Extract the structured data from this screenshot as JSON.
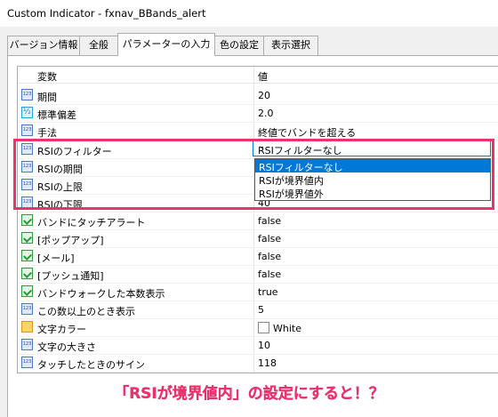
{
  "window": {
    "title": "Custom Indicator - fxnav_BBands_alert"
  },
  "tabs": [
    {
      "label": "バージョン情報"
    },
    {
      "label": "全般"
    },
    {
      "label": "パラメーターの入力"
    },
    {
      "label": "色の設定"
    },
    {
      "label": "表示選択"
    }
  ],
  "grid": {
    "col_name": "変数",
    "col_value": "値",
    "rows": [
      {
        "icon": "number-icon",
        "name": "期間",
        "value": "20"
      },
      {
        "icon": "fraction-icon",
        "name": "標準偏差",
        "value": "2.0"
      },
      {
        "icon": "number-icon",
        "name": "手法",
        "value": "終値でバンドを超える"
      },
      {
        "icon": "number-icon",
        "name": "RSIのフィルター",
        "value": "RSIフィルターなし"
      },
      {
        "icon": "number-icon",
        "name": "RSIの期間",
        "value": ""
      },
      {
        "icon": "number-icon",
        "name": "RSIの上限",
        "value": ""
      },
      {
        "icon": "number-icon",
        "name": "RSIの下限",
        "value": "40"
      },
      {
        "icon": "bool-icon",
        "name": "バンドにタッチアラート",
        "value": "false"
      },
      {
        "icon": "bool-icon",
        "name": "[ポップアップ]",
        "value": "false"
      },
      {
        "icon": "bool-icon",
        "name": "[メール]",
        "value": "false"
      },
      {
        "icon": "bool-icon",
        "name": "[プッシュ通知]",
        "value": "false"
      },
      {
        "icon": "bool-icon",
        "name": "バンドウォークした本数表示",
        "value": "true"
      },
      {
        "icon": "number-icon",
        "name": "この数以上のとき表示",
        "value": "5"
      },
      {
        "icon": "color-icon",
        "name": "文字カラー",
        "value": "White"
      },
      {
        "icon": "number-icon",
        "name": "文字の大きさ",
        "value": "10"
      },
      {
        "icon": "number-icon",
        "name": "タッチしたときのサイン",
        "value": "118"
      }
    ]
  },
  "dropdown": {
    "selected": "RSIフィルターなし",
    "options": [
      "RSIフィルターなし",
      "RSIが境界値内",
      "RSIが境界値外"
    ]
  },
  "annotation": "「RSIが境界値内」の設定にすると！？",
  "colors": {
    "accent": "#e8336d",
    "selection": "#0078d7"
  }
}
